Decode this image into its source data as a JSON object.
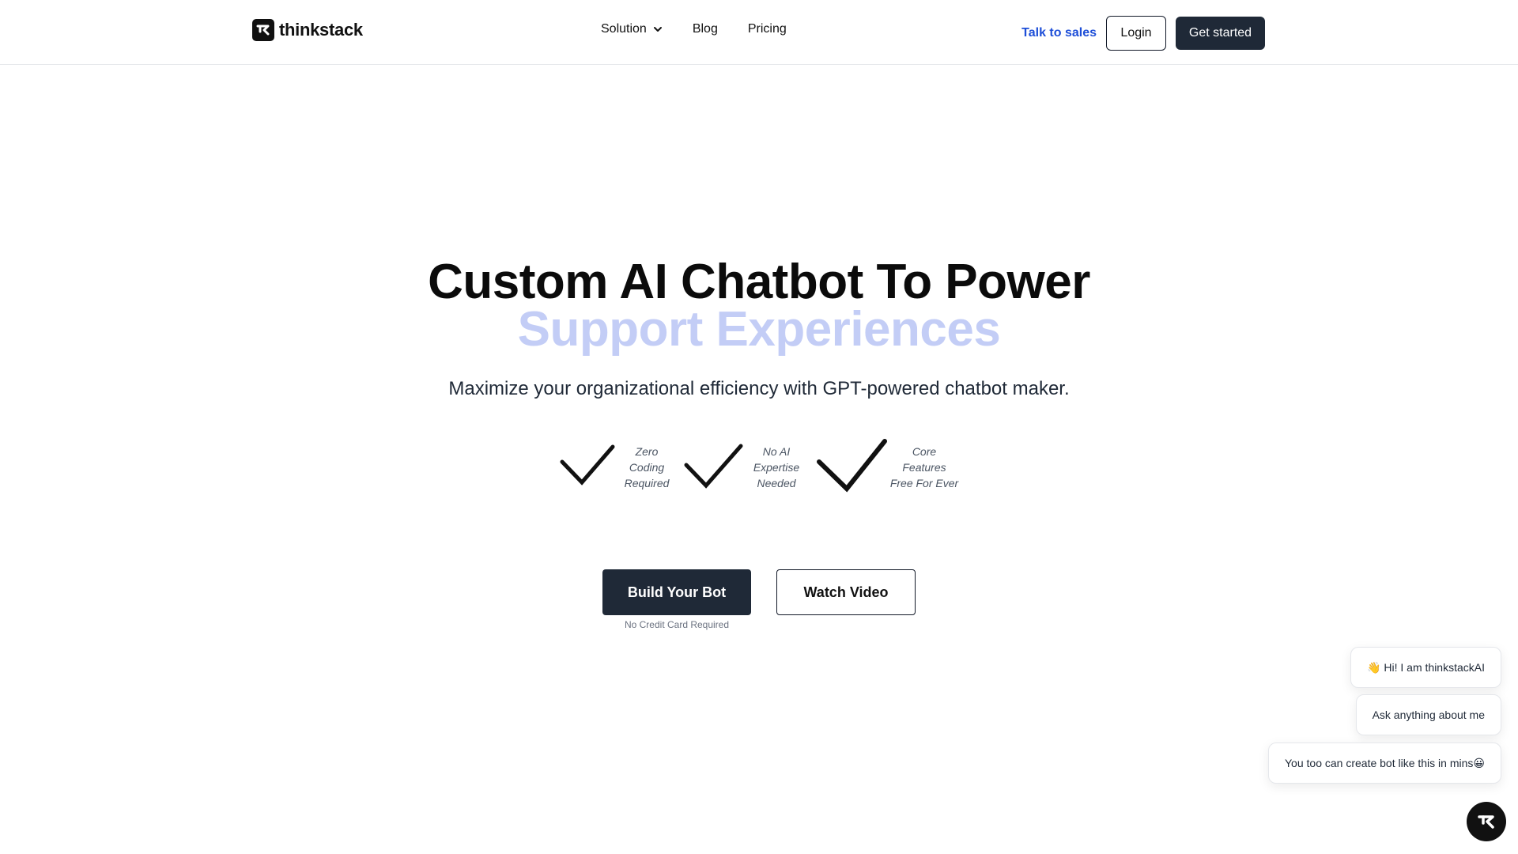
{
  "nav": {
    "logo_text": "thinkstack",
    "menu": [
      {
        "label": "Solution"
      },
      {
        "label": "Blog"
      },
      {
        "label": "Pricing"
      }
    ],
    "talk_to_sales": "Talk to sales",
    "login": "Login",
    "get_started": "Get started"
  },
  "hero": {
    "title_line1": "Custom AI Chatbot To Power",
    "title_line2": "Support Experiences",
    "subtitle": "Maximize your organizational efficiency with GPT-powered chatbot maker.",
    "features": [
      {
        "lines": [
          "Zero",
          "Coding",
          "Required"
        ]
      },
      {
        "lines": [
          "No AI",
          "Expertise",
          "Needed"
        ]
      },
      {
        "lines": [
          "Core",
          "Features",
          "Free For Ever"
        ]
      }
    ],
    "build_button": "Build Your Bot",
    "watch_button": "Watch Video",
    "no_card": "No Credit Card Required"
  },
  "chat": {
    "messages": [
      "👋 Hi! I am thinkstackAI",
      "Ask anything about me",
      "You too can create bot like this in mins😀"
    ]
  },
  "colors": {
    "primary_dark": "#1f2937",
    "accent_link": "#1d4ed8",
    "title_highlight": "#c3cdf6"
  }
}
